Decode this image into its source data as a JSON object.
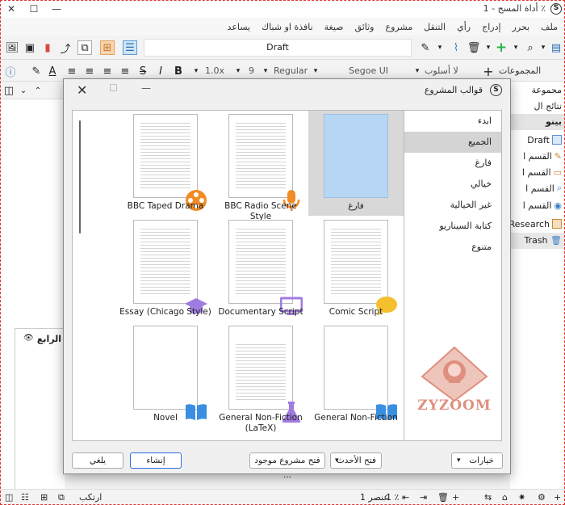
{
  "window": {
    "title": "أداة المسح - 1 ٪",
    "minimize": "—",
    "maximize": "☐",
    "close": "✕"
  },
  "menubar": [
    "ملف",
    "بحرر",
    "إدراج",
    "رأي",
    "التنقل",
    "مشروع",
    "وثائق",
    "صيغة",
    "نافذة او شباك",
    "يساعد"
  ],
  "toolbar": {
    "document_title": "Draft",
    "collections_label": "المجموعات",
    "style_label": "لا أسلوب",
    "font_name": "Segoe UI",
    "font_weight": "Regular",
    "font_size": "9",
    "line_spacing": "1.0x"
  },
  "left_panel": {
    "note_label": "الرابع"
  },
  "binder": {
    "items": [
      "مجموعة",
      "نتائج ال",
      "بينو",
      "Draft",
      "القسم ا",
      "القسم ا",
      "القسم ا",
      "القسم ا",
      "Research",
      "Trash"
    ]
  },
  "status": {
    "zoom": "1 ٪",
    "count": "1 عنصر",
    "arrange": "ارتكب"
  },
  "dialog": {
    "title": "قوالب المشروع",
    "categories": [
      {
        "label": "ابدء",
        "selected": false
      },
      {
        "label": "الجميع",
        "selected": true
      },
      {
        "label": "فارغ",
        "selected": false
      },
      {
        "label": "خيالي",
        "selected": false
      },
      {
        "label": "غير الخيالية",
        "selected": false
      },
      {
        "label": "كتابة السيناريو",
        "selected": false
      },
      {
        "label": "متنوع",
        "selected": false
      }
    ],
    "templates": [
      {
        "label": "BBC Taped Drama",
        "icon": "film-reel-icon"
      },
      {
        "label": "BBC Radio Scene Style",
        "icon": "microphone-icon"
      },
      {
        "label": "فارغ",
        "icon": "blank-page-icon"
      },
      {
        "label": "Essay (Chicago Style)",
        "icon": "graduation-cap-icon"
      },
      {
        "label": "Documentary Script",
        "icon": "monitor-icon"
      },
      {
        "label": "Comic Script",
        "icon": "speech-bubble-icon"
      },
      {
        "label": "Novel",
        "icon": "book-icon"
      },
      {
        "label": "General Non-Fiction (LaTeX)",
        "icon": "flask-icon"
      },
      {
        "label": "General Non-Fiction",
        "icon": "book-icon"
      }
    ],
    "buttons": {
      "options": "خيارات",
      "recent": "فتح الأحدث",
      "open_existing": "فتح مشروع موجود ...",
      "create": "إنشاء",
      "cancel": "يلغي"
    }
  },
  "watermark": {
    "text": "ZYZOOM"
  },
  "colors": {
    "accent_blue": "#2d6cdf",
    "badge_orange": "#f28b24",
    "badge_purple": "#a07be0",
    "badge_blue": "#3b8fe0",
    "badge_yellow": "#f5c02e",
    "blank_page": "#b7d6f3"
  }
}
